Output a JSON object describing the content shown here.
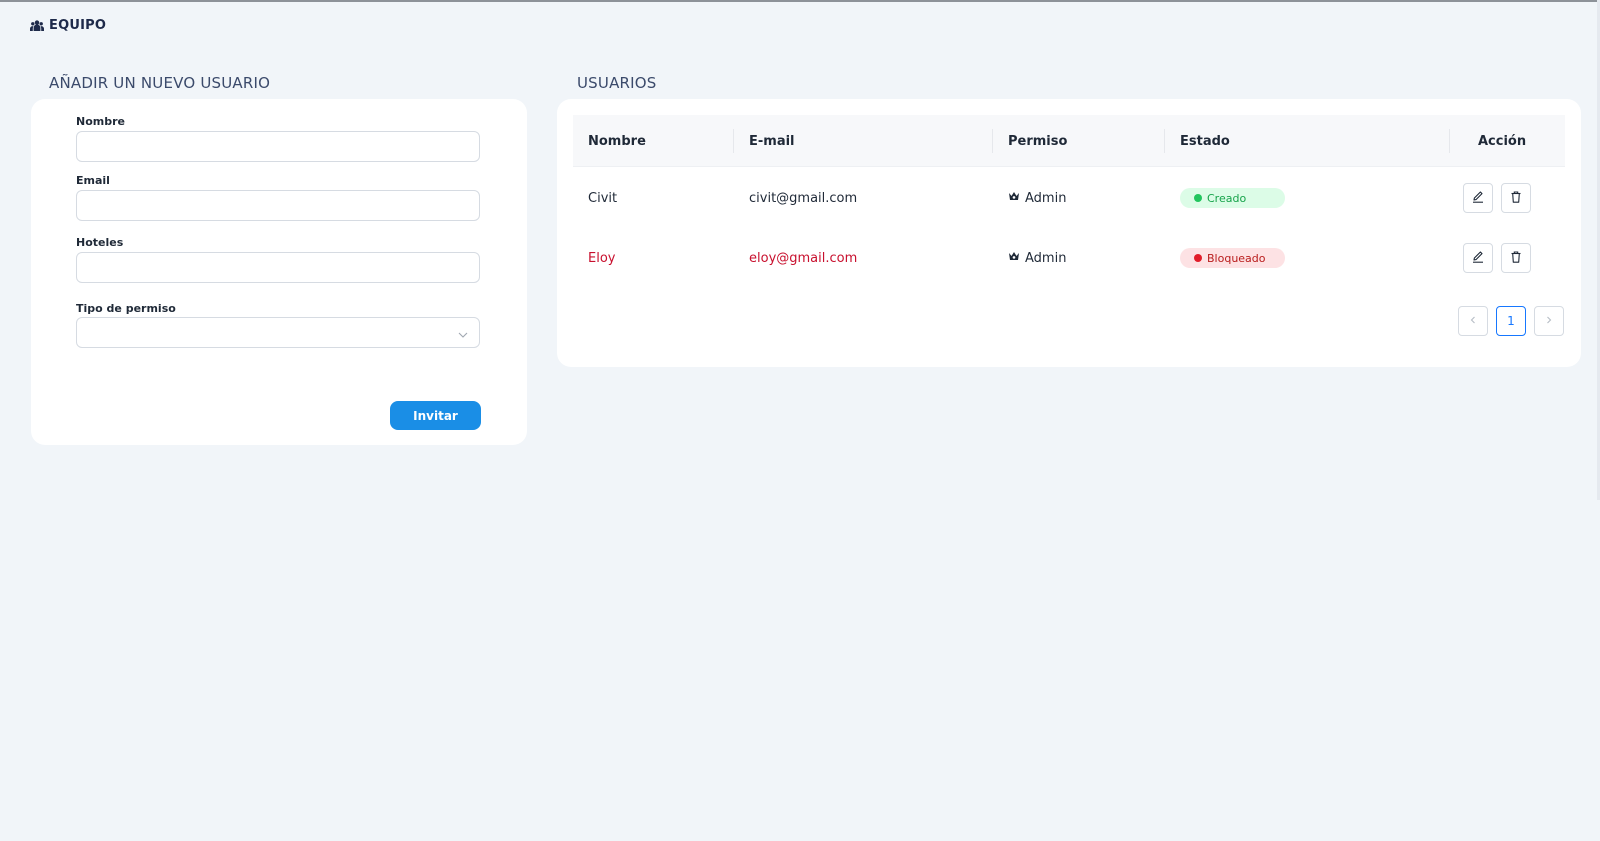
{
  "header": {
    "title": "EQUIPO",
    "icon": "team-icon"
  },
  "form": {
    "section_title": "AÑADIR UN NUEVO USUARIO",
    "fields": [
      {
        "label": "Nombre",
        "value": "",
        "placeholder": ""
      },
      {
        "label": "Email",
        "value": "",
        "placeholder": ""
      },
      {
        "label": "Hoteles",
        "value": "",
        "placeholder": ""
      }
    ],
    "permission": {
      "label": "Tipo de permiso",
      "selected": ""
    },
    "submit_label": "Invitar",
    "submit_color": "#1a8ee6"
  },
  "users": {
    "section_title": "USUARIOS",
    "columns": [
      "Nombre",
      "E-mail",
      "Permiso",
      "Estado",
      "Acción"
    ],
    "rows": [
      {
        "name": "Civit",
        "email": "civit@gmail.com",
        "permission": "Admin",
        "status": "Creado",
        "status_color": "#22c55e"
      },
      {
        "name": "Eloy",
        "email": "eloy@gmail.com",
        "permission": "Admin",
        "status": "Bloqueado",
        "status_color": "#e11d2a"
      }
    ],
    "pagination": {
      "current_page": "1"
    }
  }
}
